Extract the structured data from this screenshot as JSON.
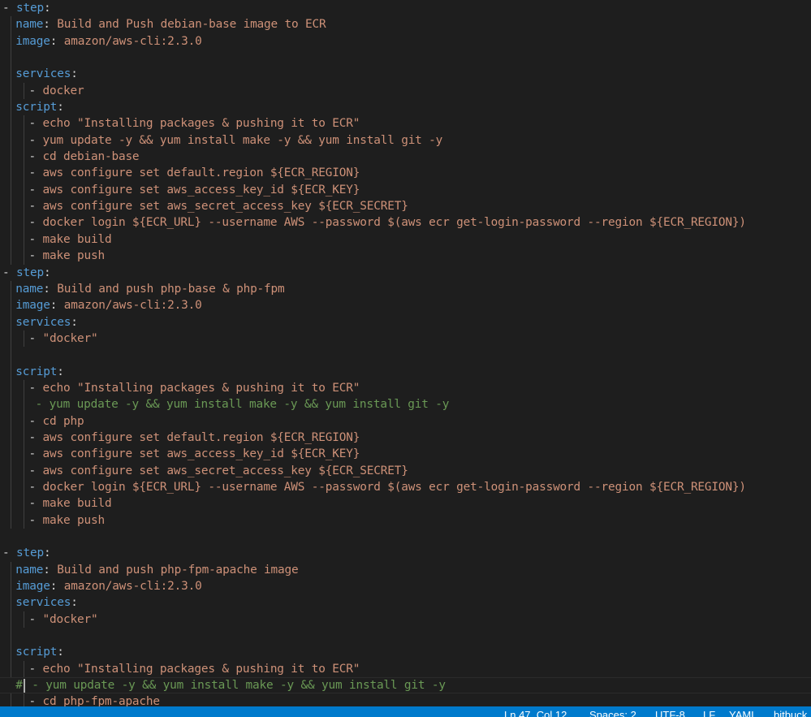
{
  "editor": {
    "language": "YAML",
    "lines": [
      [
        [
          "dash",
          "- "
        ],
        [
          "key",
          "step"
        ],
        [
          "colon",
          ":"
        ]
      ],
      [
        [
          "key",
          "name"
        ],
        [
          "colon",
          ": "
        ],
        [
          "str",
          "Build and Push debian-base image to ECR"
        ]
      ],
      [
        [
          "key",
          "image"
        ],
        [
          "colon",
          ": "
        ],
        [
          "str",
          "amazon/aws-cli:2.3.0"
        ]
      ],
      [],
      [
        [
          "key",
          "services"
        ],
        [
          "colon",
          ":"
        ]
      ],
      [
        [
          "dash",
          "- "
        ],
        [
          "str",
          "docker"
        ]
      ],
      [
        [
          "key",
          "script"
        ],
        [
          "colon",
          ":"
        ]
      ],
      [
        [
          "dash",
          "- "
        ],
        [
          "str",
          "echo \"Installing packages & pushing it to ECR\""
        ]
      ],
      [
        [
          "dash",
          "- "
        ],
        [
          "str",
          "yum update -y && yum install make -y && yum install git -y"
        ]
      ],
      [
        [
          "dash",
          "- "
        ],
        [
          "str",
          "cd debian-base"
        ]
      ],
      [
        [
          "dash",
          "- "
        ],
        [
          "str",
          "aws configure set default.region ${ECR_REGION}"
        ]
      ],
      [
        [
          "dash",
          "- "
        ],
        [
          "str",
          "aws configure set aws_access_key_id ${ECR_KEY}"
        ]
      ],
      [
        [
          "dash",
          "- "
        ],
        [
          "str",
          "aws configure set aws_secret_access_key ${ECR_SECRET}"
        ]
      ],
      [
        [
          "dash",
          "- "
        ],
        [
          "str",
          "docker login ${ECR_URL} --username AWS --password $(aws ecr get-login-password --region ${ECR_REGION})"
        ]
      ],
      [
        [
          "dash",
          "- "
        ],
        [
          "str",
          "make build"
        ]
      ],
      [
        [
          "dash",
          "- "
        ],
        [
          "str",
          "make push"
        ]
      ],
      [
        [
          "dash",
          "- "
        ],
        [
          "key",
          "step"
        ],
        [
          "colon",
          ":"
        ]
      ],
      [
        [
          "key",
          "name"
        ],
        [
          "colon",
          ": "
        ],
        [
          "str",
          "Build and push php-base & php-fpm"
        ]
      ],
      [
        [
          "key",
          "image"
        ],
        [
          "colon",
          ": "
        ],
        [
          "str",
          "amazon/aws-cli:2.3.0"
        ]
      ],
      [
        [
          "key",
          "services"
        ],
        [
          "colon",
          ":"
        ]
      ],
      [
        [
          "dash",
          "- "
        ],
        [
          "str",
          "\"docker\""
        ]
      ],
      [],
      [
        [
          "key",
          "script"
        ],
        [
          "colon",
          ":"
        ]
      ],
      [
        [
          "dash",
          "- "
        ],
        [
          "str",
          "echo \"Installing packages & pushing it to ECR\""
        ]
      ],
      [
        [
          "comment",
          "- yum update -y && yum install make -y && yum install git -y"
        ]
      ],
      [
        [
          "dash",
          "- "
        ],
        [
          "str",
          "cd php"
        ]
      ],
      [
        [
          "dash",
          "- "
        ],
        [
          "str",
          "aws configure set default.region ${ECR_REGION}"
        ]
      ],
      [
        [
          "dash",
          "- "
        ],
        [
          "str",
          "aws configure set aws_access_key_id ${ECR_KEY}"
        ]
      ],
      [
        [
          "dash",
          "- "
        ],
        [
          "str",
          "aws configure set aws_secret_access_key ${ECR_SECRET}"
        ]
      ],
      [
        [
          "dash",
          "- "
        ],
        [
          "str",
          "docker login ${ECR_URL} --username AWS --password $(aws ecr get-login-password --region ${ECR_REGION})"
        ]
      ],
      [
        [
          "dash",
          "- "
        ],
        [
          "str",
          "make build"
        ]
      ],
      [
        [
          "dash",
          "- "
        ],
        [
          "str",
          "make push"
        ]
      ],
      [],
      [
        [
          "dash",
          "- "
        ],
        [
          "key",
          "step"
        ],
        [
          "colon",
          ":"
        ]
      ],
      [
        [
          "key",
          "name"
        ],
        [
          "colon",
          ": "
        ],
        [
          "str",
          "Build and push php-fpm-apache image"
        ]
      ],
      [
        [
          "key",
          "image"
        ],
        [
          "colon",
          ": "
        ],
        [
          "str",
          "amazon/aws-cli:2.3.0"
        ]
      ],
      [
        [
          "key",
          "services"
        ],
        [
          "colon",
          ":"
        ]
      ],
      [
        [
          "dash",
          "- "
        ],
        [
          "str",
          "\"docker\""
        ]
      ],
      [],
      [
        [
          "key",
          "script"
        ],
        [
          "colon",
          ":"
        ]
      ],
      [
        [
          "dash",
          "- "
        ],
        [
          "str",
          "echo \"Installing packages & pushing it to ECR\""
        ]
      ],
      [
        [
          "comment",
          "#"
        ],
        [
          "cursor",
          ""
        ],
        [
          "comment",
          " - yum update -y && yum install make -y && yum install git -y"
        ]
      ],
      [
        [
          "dash",
          "- "
        ],
        [
          "str",
          "cd php-fpm-apache"
        ]
      ]
    ]
  },
  "statusbar": {
    "position": "Ln 47, Col 12",
    "spaces": "Spaces: 2",
    "encoding": "UTF-8",
    "eol": "LF",
    "language": "YAML",
    "extension": "bitbuck"
  }
}
